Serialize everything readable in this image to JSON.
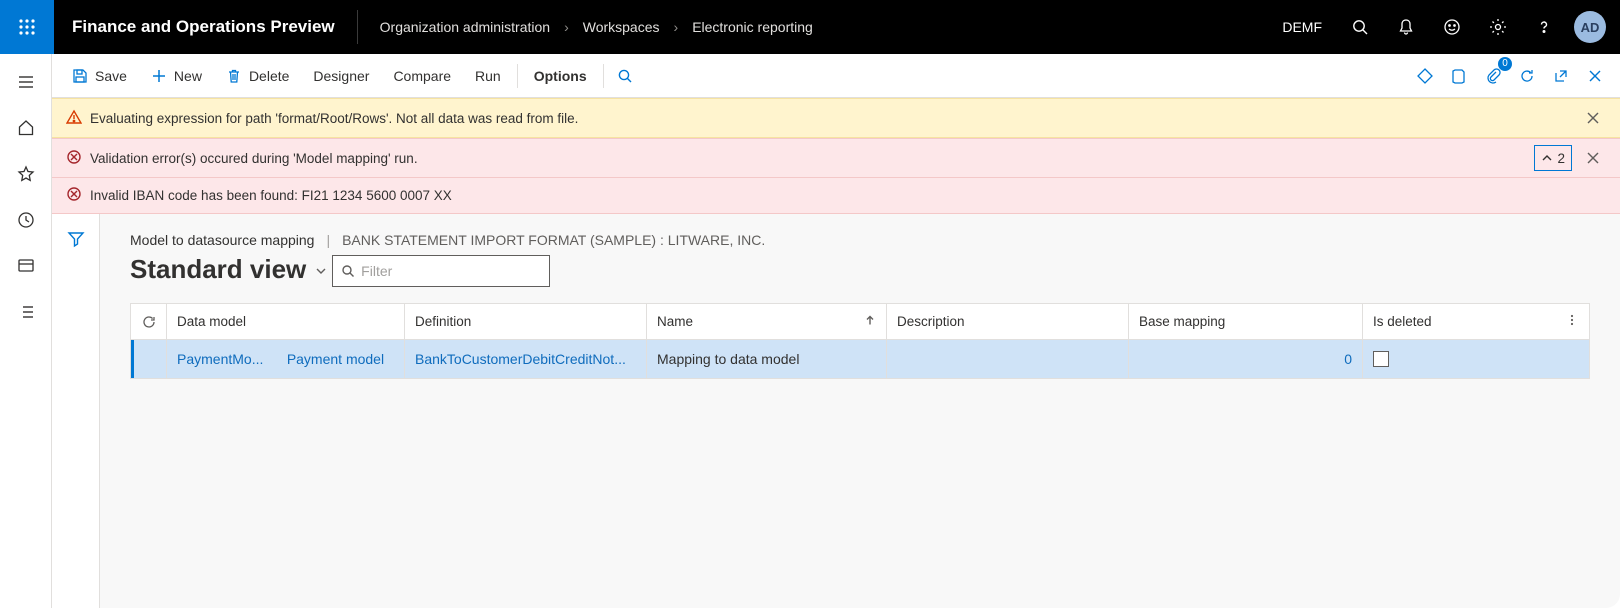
{
  "header": {
    "app_title": "Finance and Operations Preview",
    "breadcrumb": [
      "Organization administration",
      "Workspaces",
      "Electronic reporting"
    ],
    "company": "DEMF",
    "avatar_initials": "AD"
  },
  "commands": {
    "save": "Save",
    "new": "New",
    "delete": "Delete",
    "designer": "Designer",
    "compare": "Compare",
    "run": "Run",
    "options": "Options"
  },
  "attachments_badge": "0",
  "messages": {
    "warning": "Evaluating expression for path 'format/Root/Rows'.  Not all data was read from file.",
    "error1": "Validation error(s) occured during 'Model mapping' run.",
    "error2": "Invalid IBAN code has been found: FI21 1234 5600 0007 XX",
    "error_count": "2"
  },
  "page": {
    "path_main": "Model to datasource mapping",
    "path_sub": "BANK STATEMENT IMPORT FORMAT (SAMPLE) : LITWARE, INC.",
    "title": "Standard view",
    "filter_placeholder": "Filter"
  },
  "grid": {
    "columns": {
      "data_model": "Data model",
      "definition": "Definition",
      "name": "Name",
      "description": "Description",
      "base_mapping": "Base mapping",
      "is_deleted": "Is deleted"
    },
    "rows": [
      {
        "data_model_code": "PaymentMo...",
        "data_model_label": "Payment model",
        "definition": "BankToCustomerDebitCreditNot...",
        "name": "Mapping to data model",
        "description": "",
        "base_mapping": "0",
        "is_deleted": false
      }
    ]
  }
}
